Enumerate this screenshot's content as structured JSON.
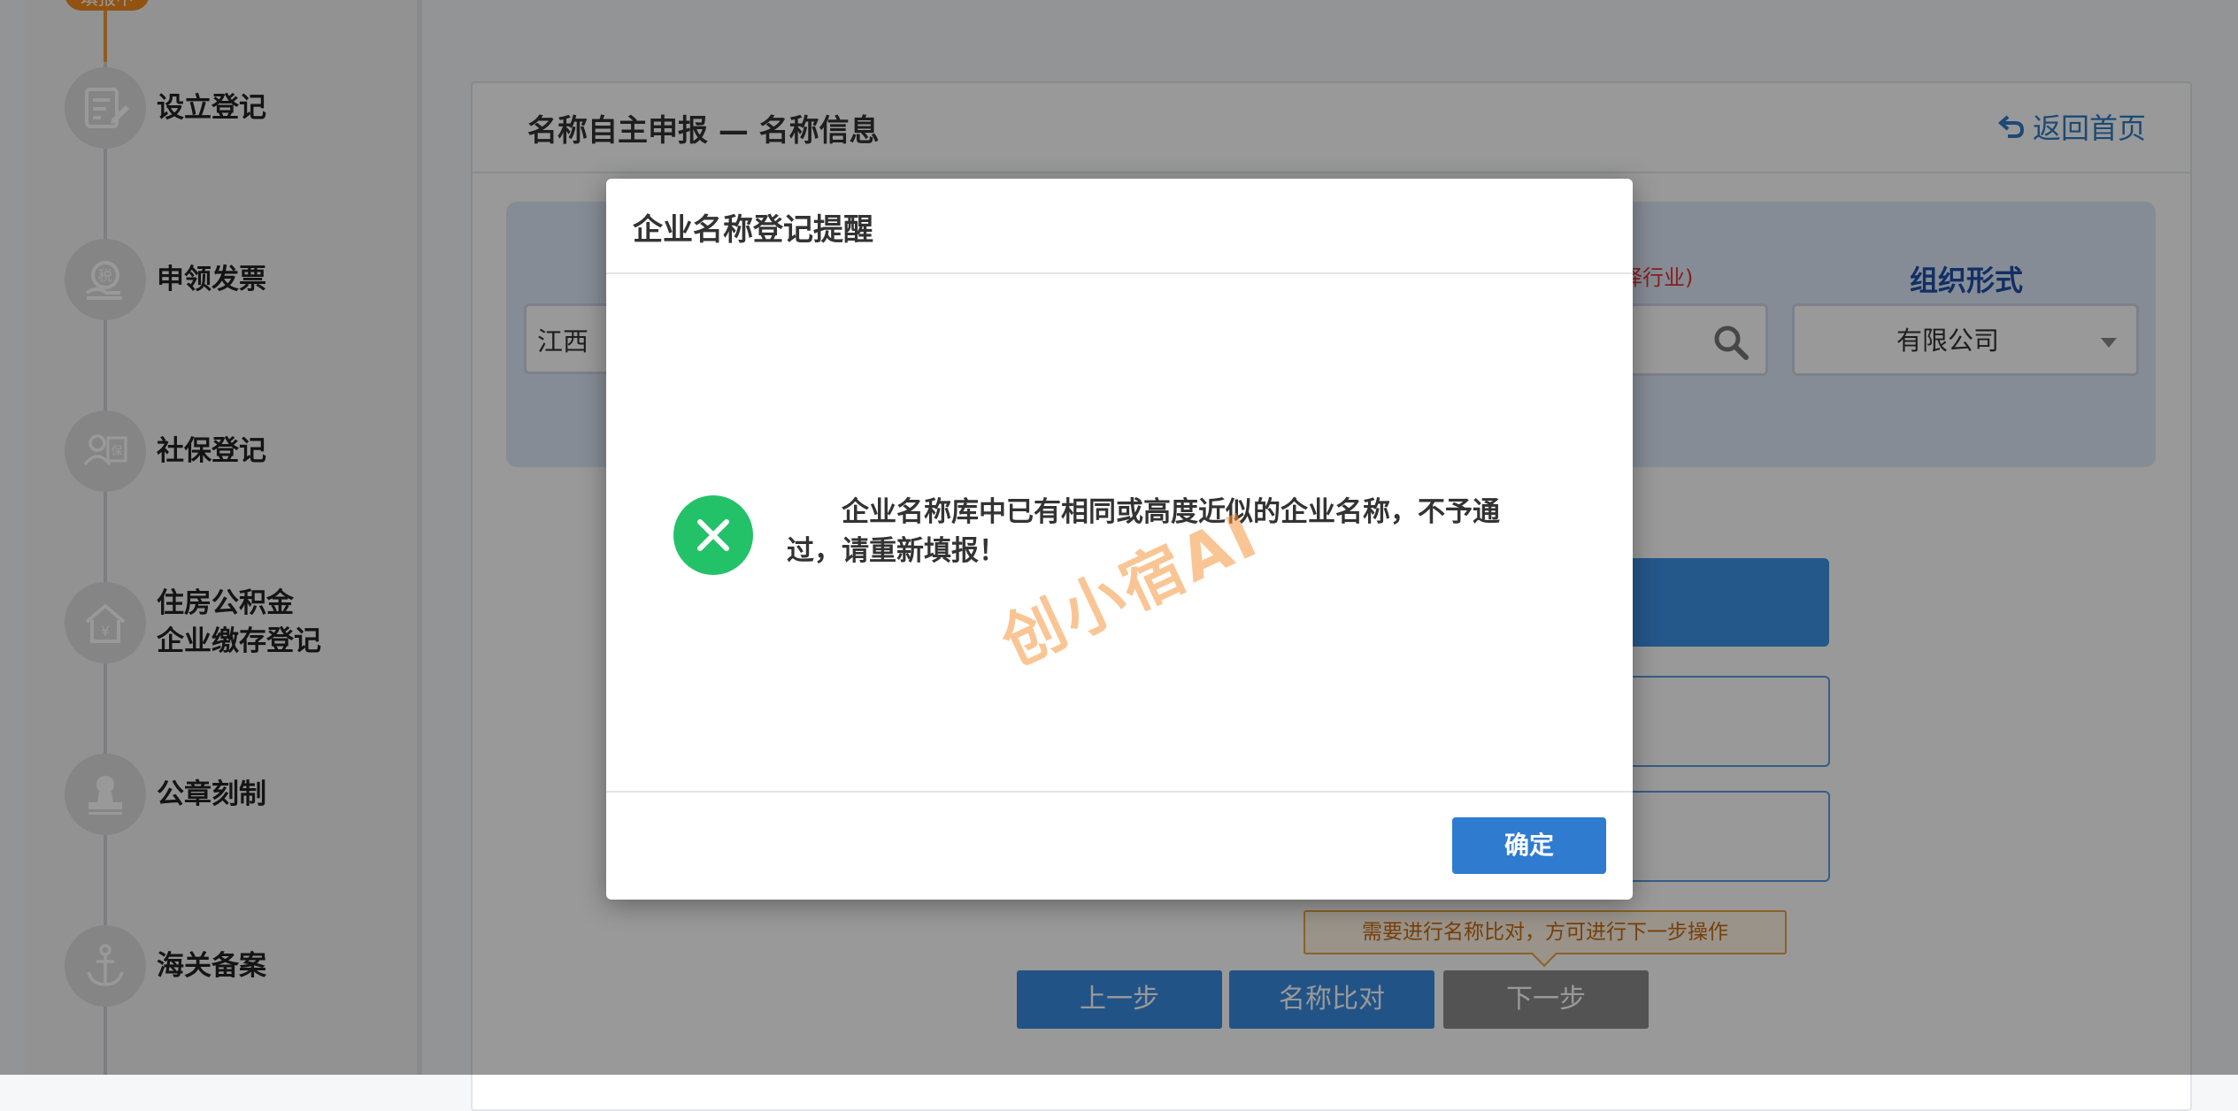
{
  "sidebar": {
    "badge": "填报中",
    "steps": [
      {
        "label_line1": "设立登记",
        "label_line2": "",
        "icon": "document-edit-icon"
      },
      {
        "label_line1": "申领发票",
        "label_line2": "",
        "icon": "tax-invoice-icon"
      },
      {
        "label_line1": "社保登记",
        "label_line2": "",
        "icon": "social-insurance-icon"
      },
      {
        "label_line1": "住房公积金",
        "label_line2": "企业缴存登记",
        "icon": "house-fund-icon"
      },
      {
        "label_line1": "公章刻制",
        "label_line2": "",
        "icon": "seal-stamp-icon"
      },
      {
        "label_line1": "海关备案",
        "label_line2": "",
        "icon": "anchor-icon"
      }
    ]
  },
  "panel": {
    "title": "名称自主申报 — 名称信息",
    "back_label": "返回首页"
  },
  "form": {
    "region_value": "江西",
    "industry_hint_fragment": "择行业)",
    "org_form_label": "组织形式",
    "org_form_value": "有限公司"
  },
  "hint": "需要进行名称比对，方可进行下一步操作",
  "buttons": {
    "prev": "上一步",
    "compare": "名称比对",
    "next": "下一步"
  },
  "modal": {
    "title": "企业名称登记提醒",
    "message": "企业名称库中已有相同或高度近似的企业名称，不予通过，请重新填报！",
    "watermark": "创小宿AI",
    "ok_label": "确定"
  },
  "colors": {
    "primary": "#2f7bd0",
    "error_icon": "#23c268",
    "badge": "#f28a1e",
    "hint_border": "#e8a43e"
  }
}
